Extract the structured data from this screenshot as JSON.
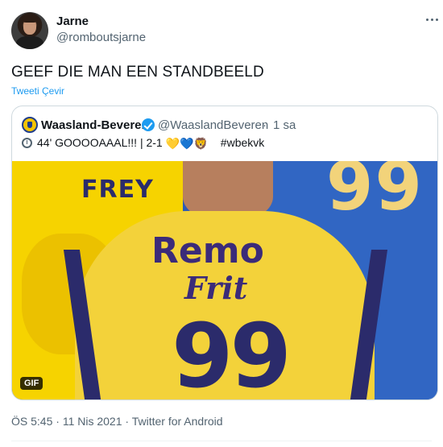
{
  "author": {
    "display_name": "Jarne",
    "handle": "@romboutsjarne",
    "avatar_icon": "profile-photo"
  },
  "more_icon": "more-horizontal-icon",
  "tweet": {
    "text": "GEEF DIE MAN EEN STANDBEELD",
    "translate_label": "Tweeti Çevir"
  },
  "quoted": {
    "display_name": "Waasland-Beveren",
    "verified": true,
    "handle": "@WaaslandBeveren",
    "separator": "·",
    "time": "1 sa",
    "text_main": "44' GOOOOAAAL!!! | 2-1",
    "emoji": [
      "💛",
      "💙",
      "🦁"
    ],
    "hashtag": "#wbekvk",
    "media": {
      "type": "gif",
      "badge": "GIF",
      "jersey_name": "FREY",
      "sponsor_line1": "Remo",
      "sponsor_line2": "Frit",
      "jersey_number": "99",
      "background_number": "99",
      "colors": {
        "yellow": "#f6d300",
        "blue": "#3166c3",
        "navy": "#2b2b6b"
      }
    }
  },
  "meta": {
    "time": "ÖS 5:45",
    "date": "11 Nis 2021",
    "source": "Twitter for Android",
    "separator": "·"
  },
  "colors": {
    "link": "#1d9bf0",
    "secondary_text": "#536471",
    "border": "#cfd9de"
  }
}
